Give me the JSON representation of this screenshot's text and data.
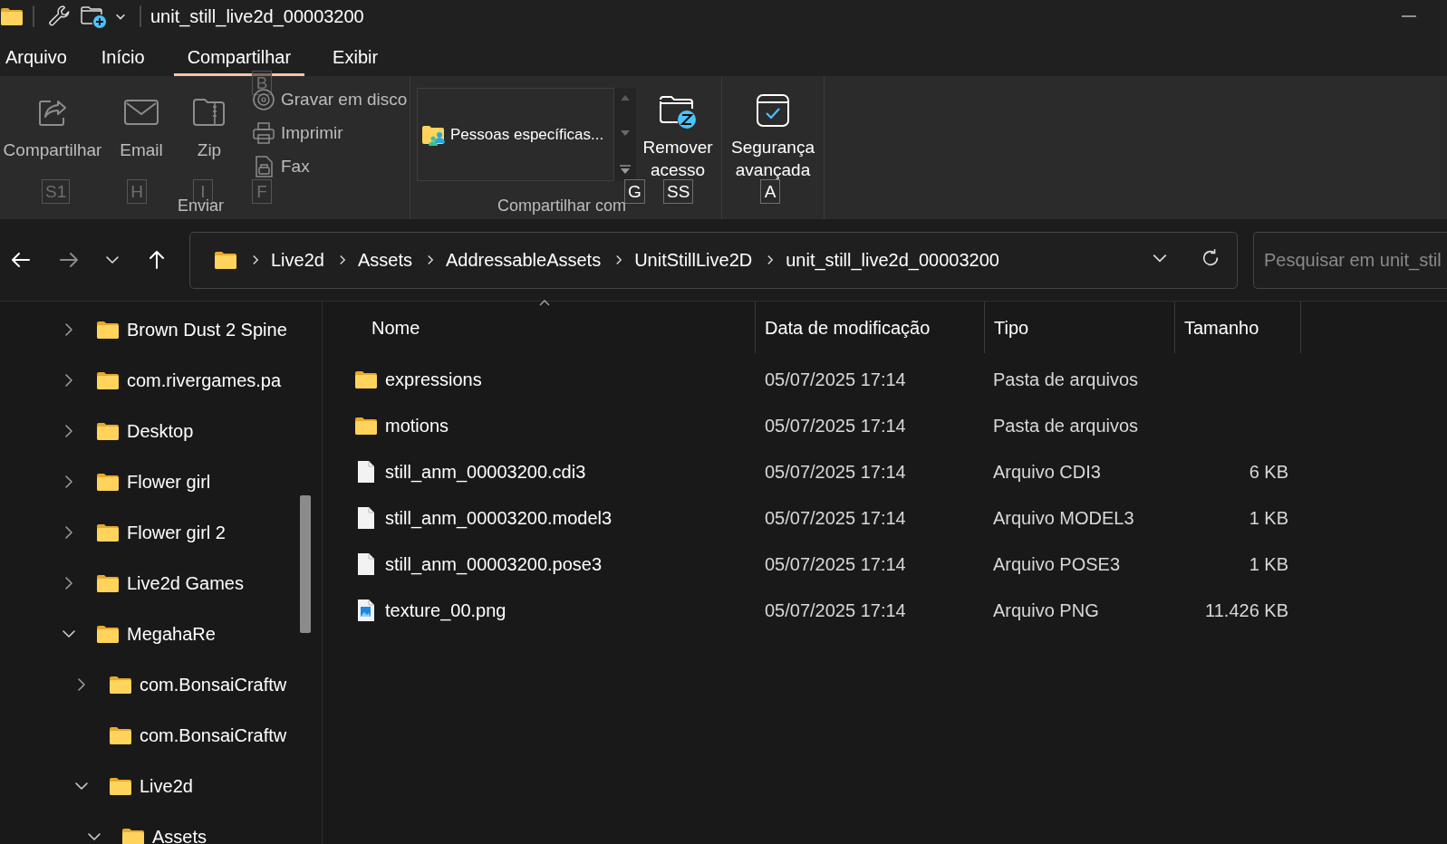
{
  "window": {
    "title": "unit_still_live2d_00003200"
  },
  "menu_tabs": [
    {
      "label": "Arquivo",
      "selected": false
    },
    {
      "label": "Início",
      "selected": false
    },
    {
      "label": "Compartilhar",
      "selected": true
    },
    {
      "label": "Exibir",
      "selected": false
    }
  ],
  "ribbon": {
    "send_group": {
      "label": "Enviar",
      "large_buttons": [
        {
          "label": "Compartilhar",
          "disabled": true,
          "keytip": "S1"
        },
        {
          "label": "Email",
          "disabled": true,
          "keytip": "H"
        },
        {
          "label": "Zip",
          "disabled": true,
          "keytip": "I"
        }
      ],
      "small_buttons": [
        {
          "label": "Gravar em disco",
          "disabled": true,
          "keytip": "B"
        },
        {
          "label": "Imprimir",
          "disabled": true
        },
        {
          "label": "Fax",
          "disabled": true,
          "keytip": "F"
        }
      ]
    },
    "share_group": {
      "label": "Compartilhar com",
      "gallery_item": "Pessoas específicas...",
      "gallery_keytip": "G",
      "buttons": [
        {
          "label": "Remover acesso",
          "disabled": false,
          "keytip": "SS"
        }
      ]
    },
    "security_group": {
      "buttons": [
        {
          "label": "Segurança avançada",
          "disabled": false,
          "keytip": "A"
        }
      ]
    }
  },
  "navigation": {
    "back": {
      "disabled": false
    },
    "forward": {
      "disabled": true
    }
  },
  "address_bar": {
    "crumbs": [
      "Live2d",
      "Assets",
      "AddressableAssets",
      "UnitStillLive2D",
      "unit_still_live2d_00003200"
    ]
  },
  "search": {
    "placeholder": "Pesquisar em unit_stil"
  },
  "sidebar": {
    "items": [
      {
        "label": "Brown Dust 2 Spine",
        "expanded": false
      },
      {
        "label": "com.rivergames.pa",
        "expanded": false
      },
      {
        "label": "Desktop",
        "expanded": false
      },
      {
        "label": "Flower girl",
        "expanded": false
      },
      {
        "label": "Flower girl 2",
        "expanded": false
      },
      {
        "label": "Live2d Games",
        "expanded": false
      },
      {
        "label": "MegahaRe",
        "expanded": true,
        "children": [
          {
            "label": "com.BonsaiCraftw",
            "expanded": false
          },
          {
            "label": "com.BonsaiCraftw"
          },
          {
            "label": "Live2d",
            "expanded": true,
            "children": [
              {
                "label": "Assets",
                "expanded": true
              }
            ]
          }
        ]
      }
    ]
  },
  "table": {
    "columns": [
      {
        "label": "Nome",
        "sorted": true
      },
      {
        "label": "Data de modificação",
        "sorted": false
      },
      {
        "label": "Tipo",
        "sorted": false
      },
      {
        "label": "Tamanho",
        "sorted": false
      }
    ],
    "rows": [
      {
        "kind": "folder",
        "name": "expressions",
        "date": "05/07/2025 17:14",
        "type": "Pasta de arquivos"
      },
      {
        "kind": "folder",
        "name": "motions",
        "date": "05/07/2025 17:14",
        "type": "Pasta de arquivos"
      },
      {
        "kind": "file",
        "name": "still_anm_00003200.cdi3",
        "date": "05/07/2025 17:14",
        "type": "Arquivo CDI3",
        "size": "6 KB"
      },
      {
        "kind": "file",
        "name": "still_anm_00003200.model3",
        "date": "05/07/2025 17:14",
        "type": "Arquivo MODEL3",
        "size": "1 KB"
      },
      {
        "kind": "file",
        "name": "still_anm_00003200.pose3",
        "date": "05/07/2025 17:14",
        "type": "Arquivo POSE3",
        "size": "1 KB"
      },
      {
        "kind": "image",
        "name": "texture_00.png",
        "date": "05/07/2025 17:14",
        "type": "Arquivo PNG",
        "size": "11.426 KB"
      }
    ]
  }
}
